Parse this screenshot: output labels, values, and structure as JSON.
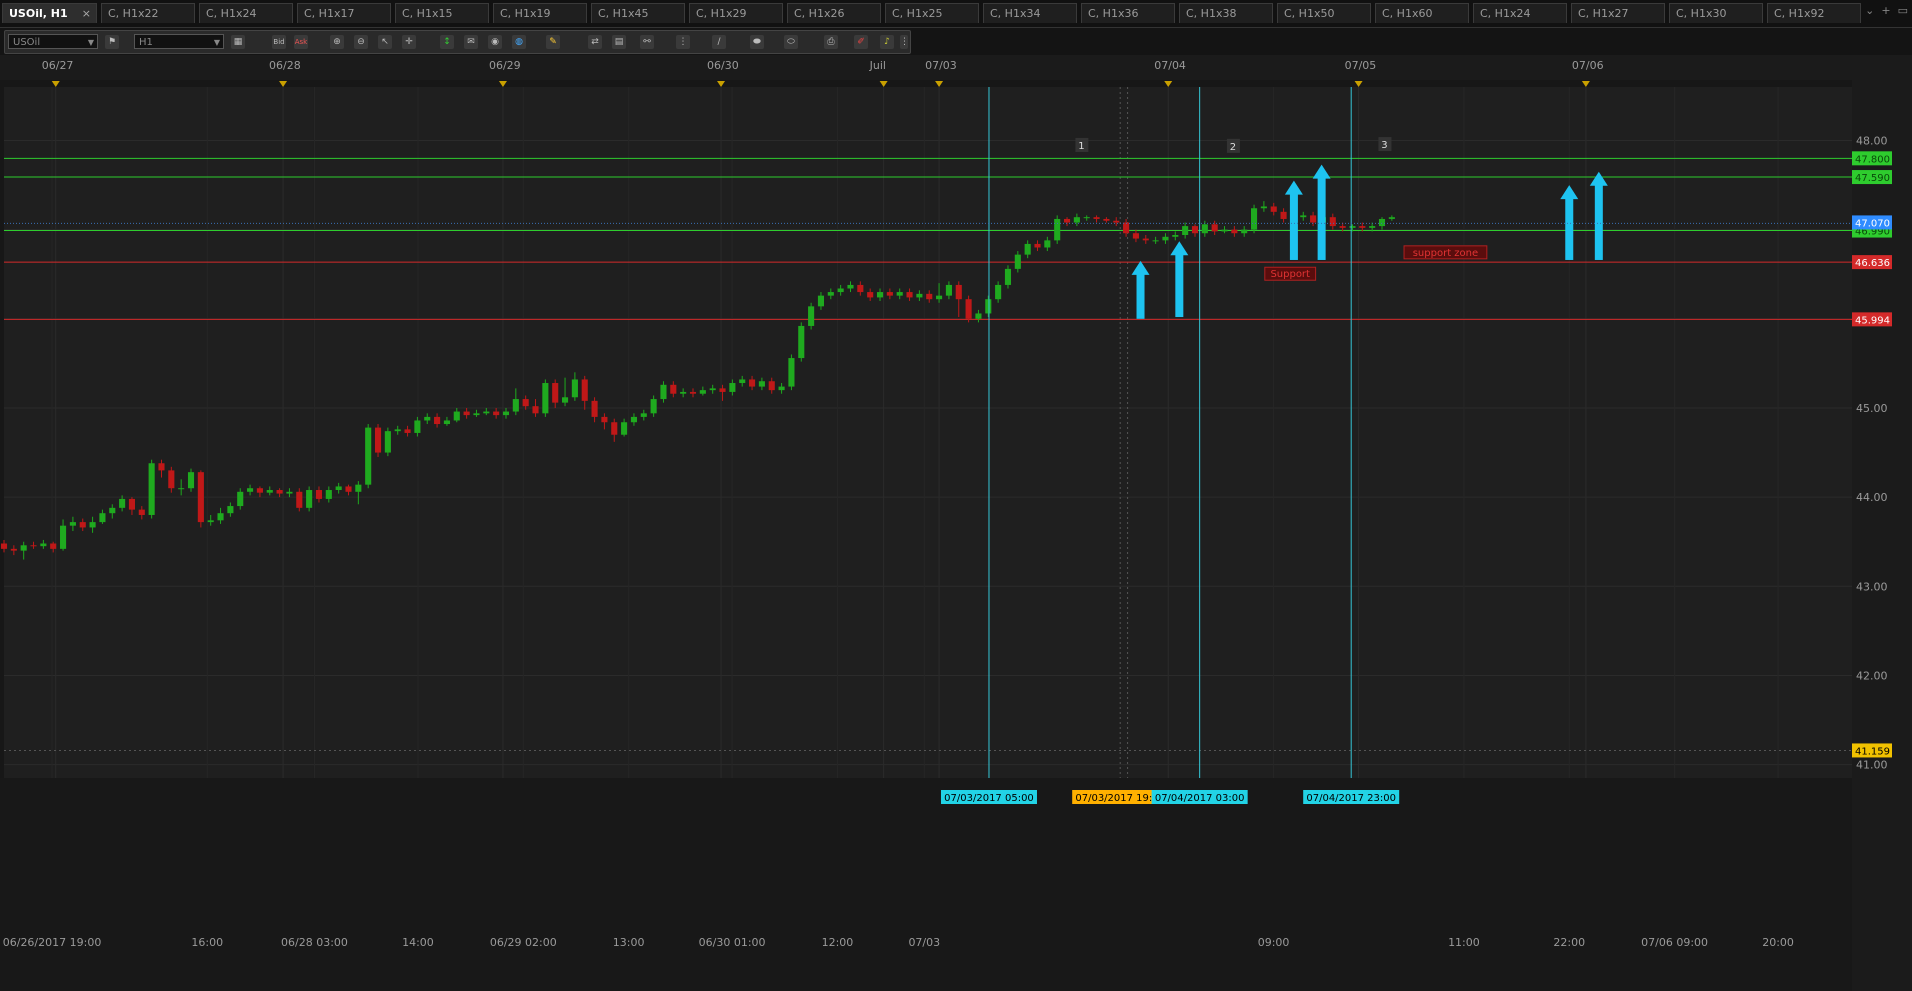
{
  "tabs": [
    {
      "label": "USOil, H1",
      "active": true
    },
    {
      "label": "C, H1x22"
    },
    {
      "label": "C, H1x24"
    },
    {
      "label": "C, H1x17"
    },
    {
      "label": "C, H1x15"
    },
    {
      "label": "C, H1x19"
    },
    {
      "label": "C, H1x45"
    },
    {
      "label": "C, H1x29"
    },
    {
      "label": "C, H1x26"
    },
    {
      "label": "C, H1x25"
    },
    {
      "label": "C, H1x34"
    },
    {
      "label": "C, H1x36"
    },
    {
      "label": "C, H1x38"
    },
    {
      "label": "C, H1x50"
    },
    {
      "label": "C, H1x60"
    },
    {
      "label": "C, H1x24"
    },
    {
      "label": "C, H1x27"
    },
    {
      "label": "C, H1x30"
    },
    {
      "label": "C, H1x92"
    }
  ],
  "toolbar": {
    "symbol_value": "USOil",
    "timeframe_value": "H1",
    "bid_label": "Bid",
    "ask_label": "Ask"
  },
  "colors": {
    "bull": "#1faa1f",
    "bear": "#c01818",
    "resistance_line": "#2ecc2e",
    "support_line": "#d42a2a",
    "vertical_marker": "#35c6d6",
    "arrow": "#1ec3f0",
    "current_price": "#2f8cff",
    "date_marker": "#c9a000"
  },
  "chart_data": {
    "type": "candlestick",
    "symbol": "USOil",
    "timeframe": "H1",
    "ylim": [
      40.85,
      48.6
    ],
    "y_ticks": [
      "48.00",
      "47.00",
      "46.00",
      "45.00",
      "44.00",
      "43.00",
      "42.00",
      "41.00"
    ],
    "top_dates": [
      {
        "label": "06/27",
        "pos": 0.028
      },
      {
        "label": "06/28",
        "pos": 0.151
      },
      {
        "label": "06/29",
        "pos": 0.27
      },
      {
        "label": "06/30",
        "pos": 0.388
      },
      {
        "label": "Juil",
        "pos": 0.476
      },
      {
        "label": "07/03",
        "pos": 0.506
      },
      {
        "label": "07/04",
        "pos": 0.63
      },
      {
        "label": "07/05",
        "pos": 0.733
      },
      {
        "label": "07/06",
        "pos": 0.856
      }
    ],
    "bottom_times": [
      {
        "label": "06/26/2017 19:00",
        "pos": 0.026
      },
      {
        "label": "16:00",
        "pos": 0.11
      },
      {
        "label": "06/28 03:00",
        "pos": 0.168
      },
      {
        "label": "14:00",
        "pos": 0.224
      },
      {
        "label": "06/29 02:00",
        "pos": 0.281
      },
      {
        "label": "13:00",
        "pos": 0.338
      },
      {
        "label": "06/30 01:00",
        "pos": 0.394
      },
      {
        "label": "12:00",
        "pos": 0.451
      },
      {
        "label": "07/03",
        "pos": 0.498
      },
      {
        "label": "09:00",
        "pos": 0.687
      },
      {
        "label": "11:00",
        "pos": 0.79
      },
      {
        "label": "22:00",
        "pos": 0.847
      },
      {
        "label": "07/06 09:00",
        "pos": 0.904
      },
      {
        "label": "20:00",
        "pos": 0.96
      }
    ],
    "time_flags": [
      {
        "label": "07/03/2017 05:00",
        "pos": 0.533,
        "color": "cyan"
      },
      {
        "label": "07/03/2017 19:00",
        "pos": 0.604,
        "color": "orange"
      },
      {
        "label": "07/04/2017 03:00",
        "pos": 0.647,
        "color": "cyan"
      },
      {
        "label": "07/04/2017 23:00",
        "pos": 0.729,
        "color": "cyan"
      }
    ],
    "horizontal_lines": [
      {
        "price": 47.8,
        "label": "47.800",
        "kind": "resistance"
      },
      {
        "price": 47.59,
        "label": "47.590",
        "kind": "resistance"
      },
      {
        "price": 46.99,
        "label": "46.990",
        "kind": "resistance"
      },
      {
        "price": 46.636,
        "label": "46.636",
        "kind": "support"
      },
      {
        "price": 45.994,
        "label": "45.994",
        "kind": "support"
      }
    ],
    "current_price": {
      "price": 47.07,
      "label": "47.070"
    },
    "bottom_price": {
      "price": 41.159,
      "label": "41.159"
    },
    "vertical_lines": [
      0.533,
      0.647,
      0.729
    ],
    "dotted_vertical_lines": [
      0.604,
      0.608
    ],
    "numbered_labels": [
      {
        "text": "1",
        "pos": 0.583,
        "price": 47.95
      },
      {
        "text": "2",
        "pos": 0.665,
        "price": 47.94
      },
      {
        "text": "3",
        "pos": 0.747,
        "price": 47.96
      }
    ],
    "annotations": [
      {
        "text": "support zone",
        "pos": 0.78,
        "price": 46.74
      },
      {
        "text": "Support",
        "pos": 0.696,
        "price": 46.5
      }
    ],
    "arrows": [
      {
        "pos": 0.615,
        "from": 46.0,
        "to": 46.65
      },
      {
        "pos": 0.636,
        "from": 46.02,
        "to": 46.87
      },
      {
        "pos": 0.698,
        "from": 46.66,
        "to": 47.55
      },
      {
        "pos": 0.713,
        "from": 46.66,
        "to": 47.73
      },
      {
        "pos": 0.847,
        "from": 46.66,
        "to": 47.5
      },
      {
        "pos": 0.863,
        "from": 46.66,
        "to": 47.65
      }
    ],
    "candles": [
      [
        43.48,
        43.42,
        43.52,
        43.38
      ],
      [
        43.42,
        43.4,
        43.46,
        43.35
      ],
      [
        43.4,
        43.46,
        43.5,
        43.3
      ],
      [
        43.46,
        43.45,
        43.5,
        43.42
      ],
      [
        43.45,
        43.48,
        43.52,
        43.42
      ],
      [
        43.48,
        43.42,
        43.5,
        43.38
      ],
      [
        43.42,
        43.68,
        43.75,
        43.4
      ],
      [
        43.68,
        43.72,
        43.78,
        43.62
      ],
      [
        43.72,
        43.66,
        43.76,
        43.62
      ],
      [
        43.66,
        43.72,
        43.78,
        43.6
      ],
      [
        43.72,
        43.82,
        43.86,
        43.7
      ],
      [
        43.82,
        43.88,
        43.92,
        43.76
      ],
      [
        43.88,
        43.98,
        44.02,
        43.84
      ],
      [
        43.98,
        43.86,
        44.0,
        43.8
      ],
      [
        43.86,
        43.8,
        43.9,
        43.75
      ],
      [
        43.8,
        44.38,
        44.42,
        43.76
      ],
      [
        44.38,
        44.3,
        44.42,
        44.22
      ],
      [
        44.3,
        44.1,
        44.34,
        44.05
      ],
      [
        44.1,
        44.1,
        44.2,
        44.02
      ],
      [
        44.1,
        44.28,
        44.32,
        44.06
      ],
      [
        44.28,
        43.72,
        44.3,
        43.66
      ],
      [
        43.72,
        43.74,
        43.8,
        43.68
      ],
      [
        43.74,
        43.82,
        43.88,
        43.7
      ],
      [
        43.82,
        43.9,
        43.94,
        43.78
      ],
      [
        43.9,
        44.06,
        44.1,
        43.86
      ],
      [
        44.06,
        44.1,
        44.14,
        44.02
      ],
      [
        44.1,
        44.05,
        44.12,
        44.0
      ],
      [
        44.05,
        44.08,
        44.12,
        44.02
      ],
      [
        44.08,
        44.04,
        44.1,
        44.0
      ],
      [
        44.04,
        44.06,
        44.1,
        44.0
      ],
      [
        44.06,
        43.88,
        44.1,
        43.84
      ],
      [
        43.88,
        44.08,
        44.12,
        43.84
      ],
      [
        44.08,
        43.98,
        44.12,
        43.94
      ],
      [
        43.98,
        44.08,
        44.12,
        43.94
      ],
      [
        44.08,
        44.12,
        44.16,
        44.04
      ],
      [
        44.12,
        44.06,
        44.14,
        44.02
      ],
      [
        44.06,
        44.14,
        44.18,
        43.92
      ],
      [
        44.14,
        44.78,
        44.82,
        44.1
      ],
      [
        44.78,
        44.5,
        44.82,
        44.45
      ],
      [
        44.5,
        44.74,
        44.78,
        44.46
      ],
      [
        44.74,
        44.76,
        44.8,
        44.7
      ],
      [
        44.76,
        44.72,
        44.8,
        44.68
      ],
      [
        44.72,
        44.86,
        44.9,
        44.68
      ],
      [
        44.86,
        44.9,
        44.94,
        44.82
      ],
      [
        44.9,
        44.82,
        44.94,
        44.78
      ],
      [
        44.82,
        44.86,
        44.9,
        44.8
      ],
      [
        44.86,
        44.96,
        45.0,
        44.84
      ],
      [
        44.96,
        44.92,
        45.0,
        44.88
      ],
      [
        44.92,
        44.94,
        44.98,
        44.9
      ],
      [
        44.94,
        44.96,
        45.0,
        44.92
      ],
      [
        44.96,
        44.92,
        45.0,
        44.88
      ],
      [
        44.92,
        44.96,
        45.0,
        44.88
      ],
      [
        44.96,
        45.1,
        45.22,
        44.92
      ],
      [
        45.1,
        45.02,
        45.14,
        44.98
      ],
      [
        45.02,
        44.94,
        45.1,
        44.9
      ],
      [
        44.94,
        45.28,
        45.32,
        44.9
      ],
      [
        45.28,
        45.06,
        45.32,
        45.0
      ],
      [
        45.06,
        45.12,
        45.34,
        45.02
      ],
      [
        45.12,
        45.32,
        45.4,
        45.08
      ],
      [
        45.32,
        45.08,
        45.36,
        44.98
      ],
      [
        45.08,
        44.9,
        45.12,
        44.84
      ],
      [
        44.9,
        44.84,
        44.94,
        44.76
      ],
      [
        44.84,
        44.7,
        44.88,
        44.62
      ],
      [
        44.7,
        44.84,
        44.88,
        44.68
      ],
      [
        44.84,
        44.9,
        44.94,
        44.8
      ],
      [
        44.9,
        44.94,
        44.98,
        44.86
      ],
      [
        44.94,
        45.1,
        45.14,
        44.9
      ],
      [
        45.1,
        45.26,
        45.3,
        45.06
      ],
      [
        45.26,
        45.16,
        45.3,
        45.12
      ],
      [
        45.16,
        45.18,
        45.22,
        45.12
      ],
      [
        45.18,
        45.16,
        45.22,
        45.12
      ],
      [
        45.16,
        45.2,
        45.24,
        45.14
      ],
      [
        45.2,
        45.22,
        45.26,
        45.16
      ],
      [
        45.22,
        45.18,
        45.26,
        45.08
      ],
      [
        45.18,
        45.28,
        45.32,
        45.14
      ],
      [
        45.28,
        45.32,
        45.36,
        45.24
      ],
      [
        45.32,
        45.24,
        45.36,
        45.2
      ],
      [
        45.24,
        45.3,
        45.34,
        45.2
      ],
      [
        45.3,
        45.2,
        45.34,
        45.16
      ],
      [
        45.2,
        45.24,
        45.28,
        45.16
      ],
      [
        45.24,
        45.56,
        45.6,
        45.2
      ],
      [
        45.56,
        45.92,
        45.96,
        45.52
      ],
      [
        45.92,
        46.14,
        46.18,
        45.88
      ],
      [
        46.14,
        46.26,
        46.3,
        46.1
      ],
      [
        46.26,
        46.3,
        46.34,
        46.22
      ],
      [
        46.3,
        46.34,
        46.38,
        46.26
      ],
      [
        46.34,
        46.38,
        46.42,
        46.3
      ],
      [
        46.38,
        46.3,
        46.42,
        46.26
      ],
      [
        46.3,
        46.24,
        46.34,
        46.2
      ],
      [
        46.24,
        46.3,
        46.34,
        46.2
      ],
      [
        46.3,
        46.26,
        46.34,
        46.22
      ],
      [
        46.26,
        46.3,
        46.34,
        46.22
      ],
      [
        46.3,
        46.24,
        46.34,
        46.2
      ],
      [
        46.24,
        46.28,
        46.32,
        46.2
      ],
      [
        46.28,
        46.22,
        46.32,
        46.18
      ],
      [
        46.22,
        46.26,
        46.4,
        46.18
      ],
      [
        46.26,
        46.38,
        46.42,
        46.22
      ],
      [
        46.38,
        46.22,
        46.42,
        46.02
      ],
      [
        46.22,
        46.0,
        46.26,
        45.96
      ],
      [
        46.0,
        46.06,
        46.1,
        45.96
      ],
      [
        46.06,
        46.22,
        46.26,
        46.02
      ],
      [
        46.22,
        46.38,
        46.42,
        46.18
      ],
      [
        46.38,
        46.56,
        46.6,
        46.34
      ],
      [
        46.56,
        46.72,
        46.76,
        46.52
      ],
      [
        46.72,
        46.84,
        46.88,
        46.68
      ],
      [
        46.84,
        46.8,
        46.88,
        46.76
      ],
      [
        46.8,
        46.88,
        46.92,
        46.76
      ],
      [
        46.88,
        47.12,
        47.16,
        46.84
      ],
      [
        47.12,
        47.08,
        47.14,
        47.04
      ],
      [
        47.08,
        47.14,
        47.18,
        47.04
      ],
      [
        47.14,
        47.14,
        47.16,
        47.1
      ],
      [
        47.14,
        47.12,
        47.16,
        47.08
      ],
      [
        47.12,
        47.1,
        47.14,
        47.08
      ],
      [
        47.1,
        47.08,
        47.14,
        47.04
      ],
      [
        47.08,
        46.96,
        47.12,
        46.92
      ],
      [
        46.96,
        46.9,
        47.0,
        46.86
      ],
      [
        46.9,
        46.88,
        46.94,
        46.84
      ],
      [
        46.88,
        46.88,
        46.92,
        46.84
      ],
      [
        46.88,
        46.92,
        46.96,
        46.84
      ],
      [
        46.92,
        46.94,
        46.98,
        46.88
      ],
      [
        46.94,
        47.04,
        47.08,
        46.9
      ],
      [
        47.04,
        46.96,
        47.06,
        46.92
      ],
      [
        46.96,
        47.06,
        47.1,
        46.92
      ],
      [
        47.06,
        46.98,
        47.1,
        46.94
      ],
      [
        46.98,
        47.0,
        47.04,
        46.96
      ],
      [
        47.0,
        46.96,
        47.04,
        46.92
      ],
      [
        46.96,
        47.0,
        47.04,
        46.92
      ],
      [
        47.0,
        47.24,
        47.28,
        46.96
      ],
      [
        47.24,
        47.26,
        47.32,
        47.2
      ],
      [
        47.26,
        47.2,
        47.3,
        47.16
      ],
      [
        47.2,
        47.12,
        47.24,
        47.08
      ],
      [
        47.12,
        47.14,
        47.18,
        47.08
      ],
      [
        47.14,
        47.16,
        47.2,
        47.1
      ],
      [
        47.16,
        47.08,
        47.2,
        47.04
      ],
      [
        47.08,
        47.14,
        47.18,
        47.04
      ],
      [
        47.14,
        47.04,
        47.18,
        47.0
      ],
      [
        47.04,
        47.02,
        47.08,
        46.98
      ],
      [
        47.02,
        47.04,
        47.06,
        46.98
      ],
      [
        47.04,
        47.02,
        47.08,
        46.98
      ],
      [
        47.02,
        47.04,
        47.08,
        46.98
      ],
      [
        47.04,
        47.12,
        47.14,
        47.0
      ],
      [
        47.12,
        47.14,
        47.16,
        47.1
      ]
    ]
  }
}
